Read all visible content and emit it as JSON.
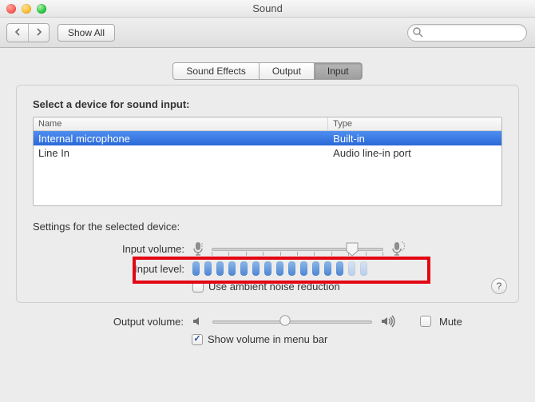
{
  "window": {
    "title": "Sound"
  },
  "toolbar": {
    "show_all": "Show All",
    "search_placeholder": ""
  },
  "tabs": [
    {
      "id": "sound-effects",
      "label": "Sound Effects",
      "active": false
    },
    {
      "id": "output",
      "label": "Output",
      "active": false
    },
    {
      "id": "input",
      "label": "Input",
      "active": true
    }
  ],
  "input_pane": {
    "select_label": "Select a device for sound input:",
    "columns": {
      "name": "Name",
      "type": "Type"
    },
    "devices": [
      {
        "name": "Internal microphone",
        "type": "Built-in",
        "selected": true
      },
      {
        "name": "Line In",
        "type": "Audio line-in port",
        "selected": false
      }
    ],
    "settings_label": "Settings for the selected device:",
    "input_volume_label": "Input volume:",
    "input_volume_percent": 82,
    "input_level_label": "Input level:",
    "input_level_segments": 15,
    "input_level_lit": 13,
    "ambient_label": "Use ambient noise reduction",
    "ambient_checked": false
  },
  "footer": {
    "output_volume_label": "Output volume:",
    "output_volume_percent": 46,
    "mute_label": "Mute",
    "mute_checked": false,
    "menubar_label": "Show volume in menu bar",
    "menubar_checked": true
  },
  "help_label": "?"
}
